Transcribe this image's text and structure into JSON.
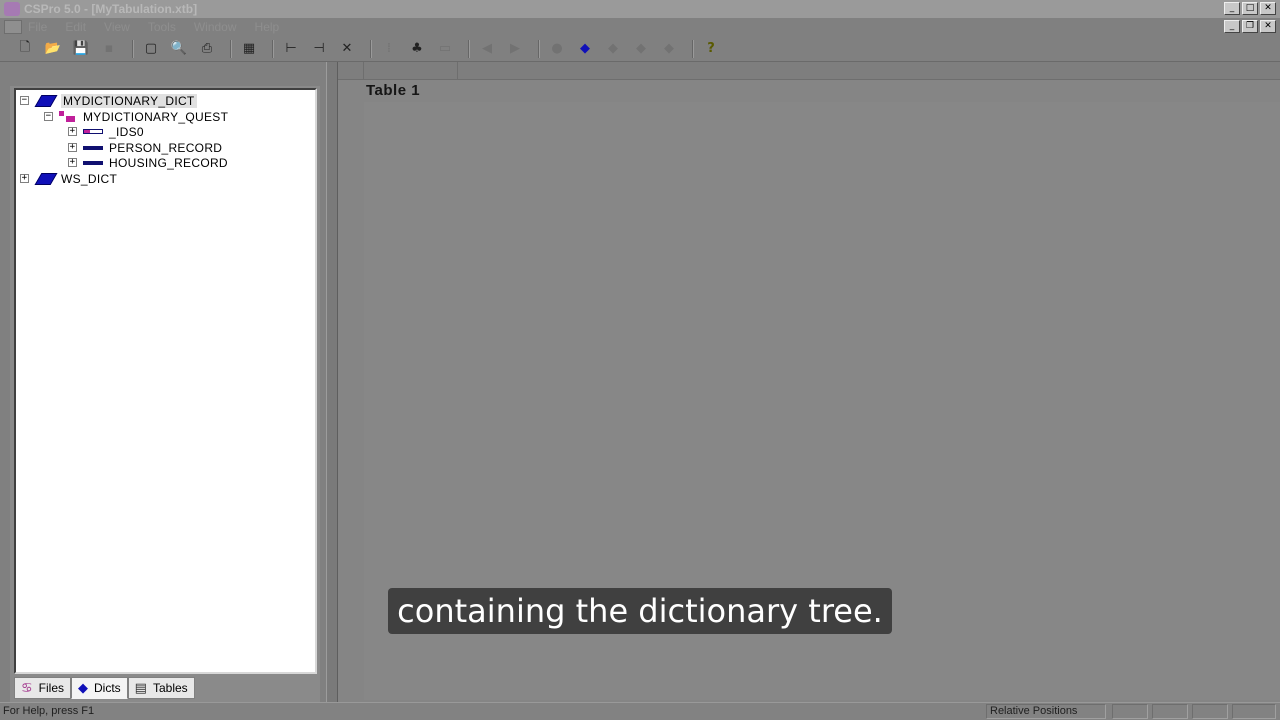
{
  "window": {
    "title": "CSPro 5.0 - [MyTabulation.xtb]",
    "minimize_glyph": "_",
    "maximize_glyph": "□",
    "close_glyph": "✕",
    "restore_glyph": "❐"
  },
  "menubar": {
    "items": [
      "File",
      "Edit",
      "View",
      "Tools",
      "Window",
      "Help"
    ]
  },
  "toolbar": {
    "buttons": [
      {
        "icon": "new-icon",
        "glyph": "🗋"
      },
      {
        "icon": "open-icon",
        "glyph": "📂"
      },
      {
        "icon": "save-icon",
        "glyph": "💾"
      },
      {
        "icon": "run-icon",
        "glyph": "▪"
      },
      {
        "icon": "frame-icon",
        "glyph": "▢"
      },
      {
        "icon": "print-preview-icon",
        "glyph": "🔍"
      },
      {
        "icon": "print-icon",
        "glyph": "⎙"
      },
      {
        "icon": "tabulate-icon",
        "glyph": "▦"
      },
      {
        "icon": "add-row-icon",
        "glyph": "⊢"
      },
      {
        "icon": "add-column-icon",
        "glyph": "⊣"
      },
      {
        "icon": "delete-icon",
        "glyph": "✕"
      },
      {
        "icon": "area-icon",
        "glyph": "⁞"
      },
      {
        "icon": "tree-icon",
        "glyph": "♣"
      },
      {
        "icon": "copy-icon",
        "glyph": "▭"
      },
      {
        "icon": "back-icon",
        "glyph": "◀"
      },
      {
        "icon": "forward-icon",
        "glyph": "▶"
      },
      {
        "icon": "stop-icon",
        "glyph": "●"
      },
      {
        "icon": "dictionary-icon",
        "glyph": "◆"
      },
      {
        "icon": "dict-2-icon",
        "glyph": "◆"
      },
      {
        "icon": "dict-3-icon",
        "glyph": "◆"
      },
      {
        "icon": "dict-4-icon",
        "glyph": "◆"
      },
      {
        "icon": "help-icon",
        "glyph": "?"
      }
    ]
  },
  "tree": {
    "expanded_glyph": "−",
    "collapsed_glyph": "+",
    "nodes": [
      {
        "label": "MYDICTIONARY_DICT",
        "level": 0,
        "expander": "−",
        "icon": "dictionary-book-icon",
        "selected": true
      },
      {
        "label": "MYDICTIONARY_QUEST",
        "level": 1,
        "expander": "−",
        "icon": "questionnaire-icon"
      },
      {
        "label": "_IDS0",
        "level": 2,
        "expander": "+",
        "icon": "id-record-icon"
      },
      {
        "label": "PERSON_RECORD",
        "level": 2,
        "expander": "+",
        "icon": "record-icon"
      },
      {
        "label": "HOUSING_RECORD",
        "level": 2,
        "expander": "+",
        "icon": "record-icon"
      },
      {
        "label": "WS_DICT",
        "level": 0,
        "expander": "+",
        "icon": "dictionary-book-icon"
      }
    ]
  },
  "tabs": [
    {
      "label": "Files",
      "icon": "files-icon",
      "glyph": "♋"
    },
    {
      "label": "Dicts",
      "icon": "dicts-icon",
      "glyph": "◆",
      "active": true
    },
    {
      "label": "Tables",
      "icon": "tables-icon",
      "glyph": "▤"
    }
  ],
  "main": {
    "table_title": "Table 1"
  },
  "statusbar": {
    "help_text": "For Help, press F1",
    "position_mode": "Relative Positions"
  },
  "caption": {
    "text": "containing the dictionary tree."
  }
}
